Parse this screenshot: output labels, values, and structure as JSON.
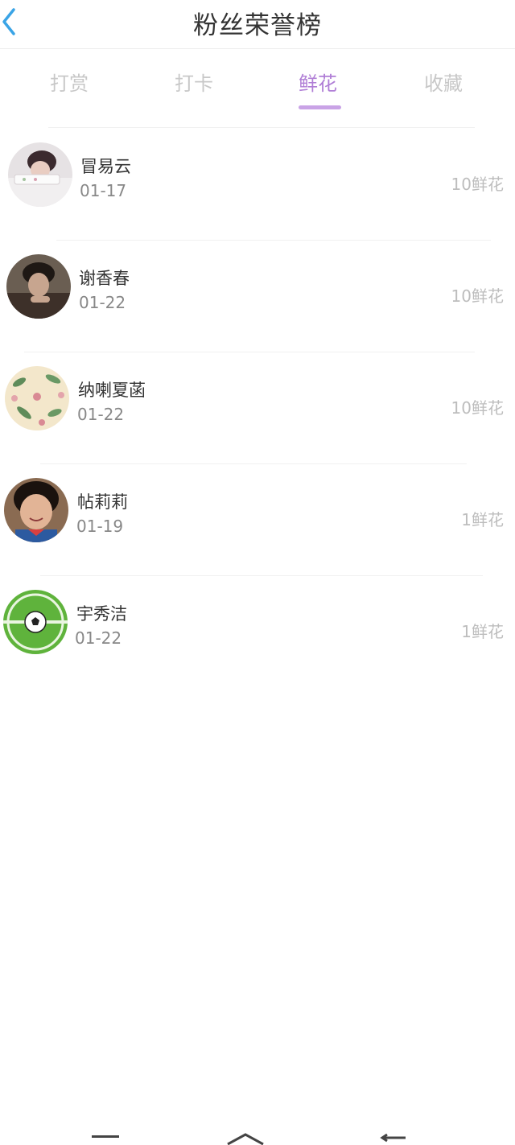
{
  "header": {
    "title": "粉丝荣誉榜"
  },
  "tabs": [
    {
      "label": "打赏",
      "active": false
    },
    {
      "label": "打卡",
      "active": false
    },
    {
      "label": "鲜花",
      "active": true
    },
    {
      "label": "收藏",
      "active": false
    }
  ],
  "accent_color": "#b07ed6",
  "fans": [
    {
      "name": "冒易云",
      "date": "01-17",
      "amount": "10鲜花",
      "avatar": "person-photo"
    },
    {
      "name": "谢香春",
      "date": "01-22",
      "amount": "10鲜花",
      "avatar": "person-photo"
    },
    {
      "name": "纳喇夏菡",
      "date": "01-22",
      "amount": "10鲜花",
      "avatar": "floral-pattern"
    },
    {
      "name": "帖莉莉",
      "date": "01-19",
      "amount": "1鲜花",
      "avatar": "child-photo"
    },
    {
      "name": "宇秀洁",
      "date": "01-22",
      "amount": "1鲜花",
      "avatar": "soccer-ball"
    }
  ]
}
